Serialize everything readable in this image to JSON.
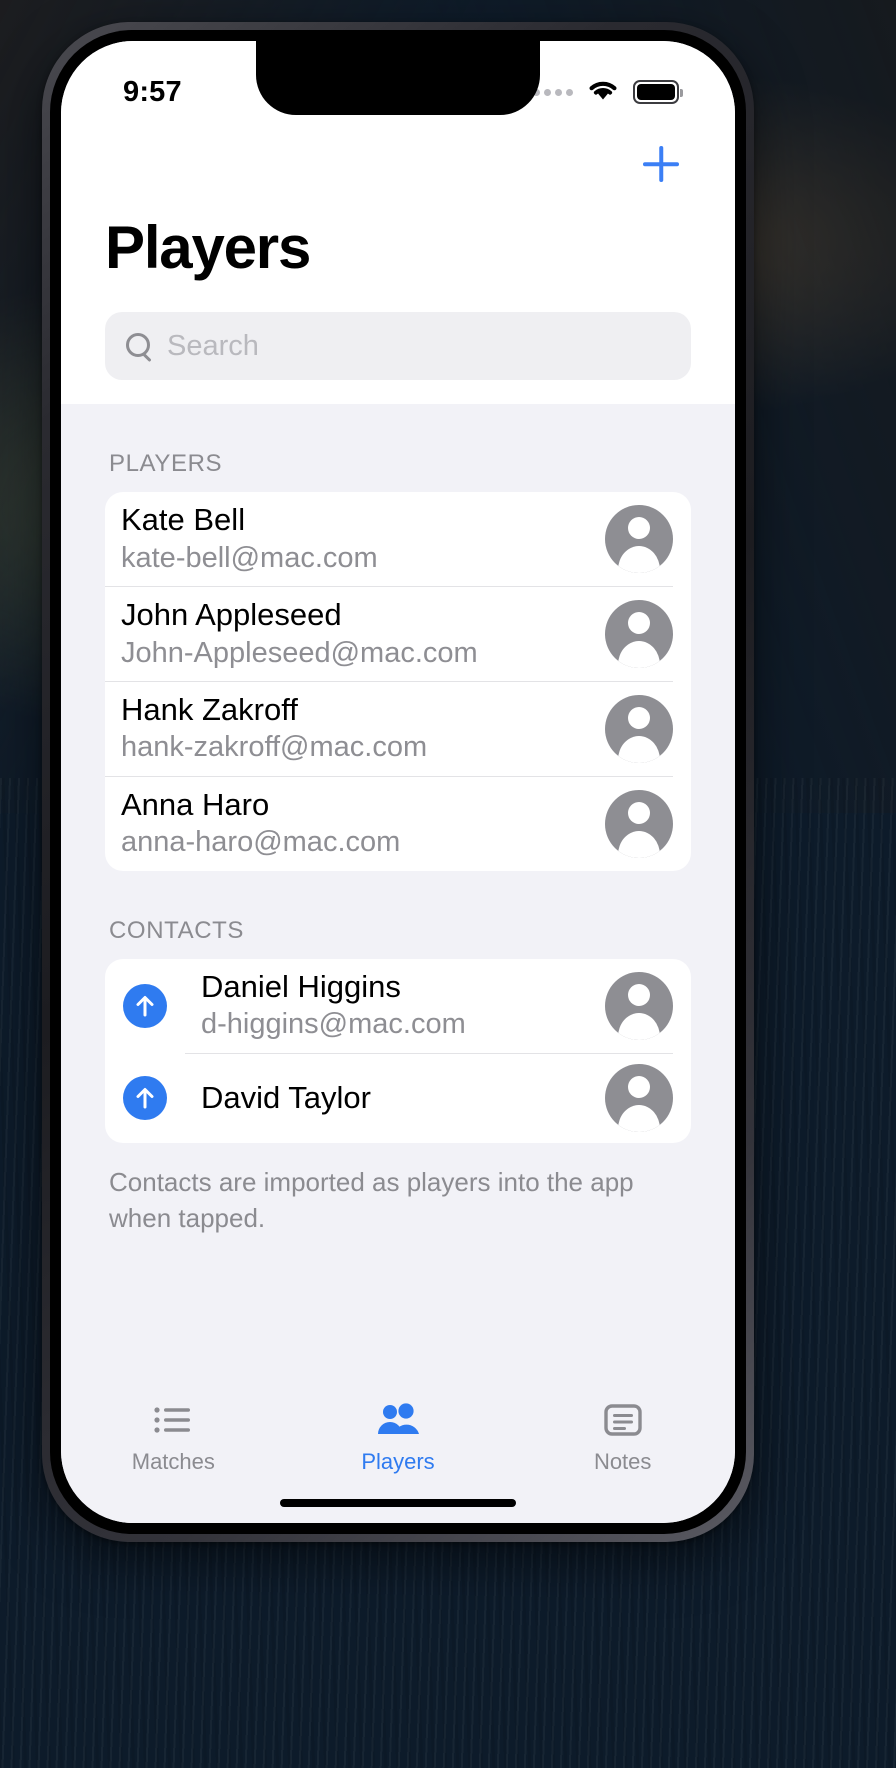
{
  "status_bar": {
    "time": "9:57",
    "signal_icon": "signal-dots-icon",
    "wifi_icon": "wifi-icon",
    "battery_icon": "battery-icon"
  },
  "nav": {
    "add_icon": "plus-icon",
    "title": "Players"
  },
  "search": {
    "icon": "search-icon",
    "placeholder": "Search",
    "value": ""
  },
  "sections": [
    {
      "header": "PLAYERS",
      "rows": [
        {
          "name": "Kate Bell",
          "email": "kate-bell@mac.com",
          "avatar_icon": "person-avatar-icon"
        },
        {
          "name": "John Appleseed",
          "email": "John-Appleseed@mac.com",
          "avatar_icon": "person-avatar-icon"
        },
        {
          "name": "Hank Zakroff",
          "email": "hank-zakroff@mac.com",
          "avatar_icon": "person-avatar-icon"
        },
        {
          "name": "Anna Haro",
          "email": "anna-haro@mac.com",
          "avatar_icon": "person-avatar-icon"
        }
      ]
    },
    {
      "header": "CONTACTS",
      "footnote": "Contacts are imported as players into the app when tapped.",
      "rows": [
        {
          "name": "Daniel Higgins",
          "email": "d-higgins@mac.com",
          "import_icon": "arrow-up-circle-icon",
          "avatar_icon": "person-avatar-icon"
        },
        {
          "name": "David Taylor",
          "email": "",
          "import_icon": "arrow-up-circle-icon",
          "avatar_icon": "person-avatar-icon"
        }
      ]
    }
  ],
  "tab_bar": {
    "tabs": [
      {
        "label": "Matches",
        "icon": "list-bullet-icon",
        "active": false
      },
      {
        "label": "Players",
        "icon": "people-icon",
        "active": true
      },
      {
        "label": "Notes",
        "icon": "note-icon",
        "active": false
      }
    ]
  },
  "colors": {
    "accent": "#2f7bf0",
    "add_button": "#3b7ff5",
    "background": "#f2f2f7",
    "card": "#ffffff",
    "secondary_text": "#8e8e93"
  }
}
